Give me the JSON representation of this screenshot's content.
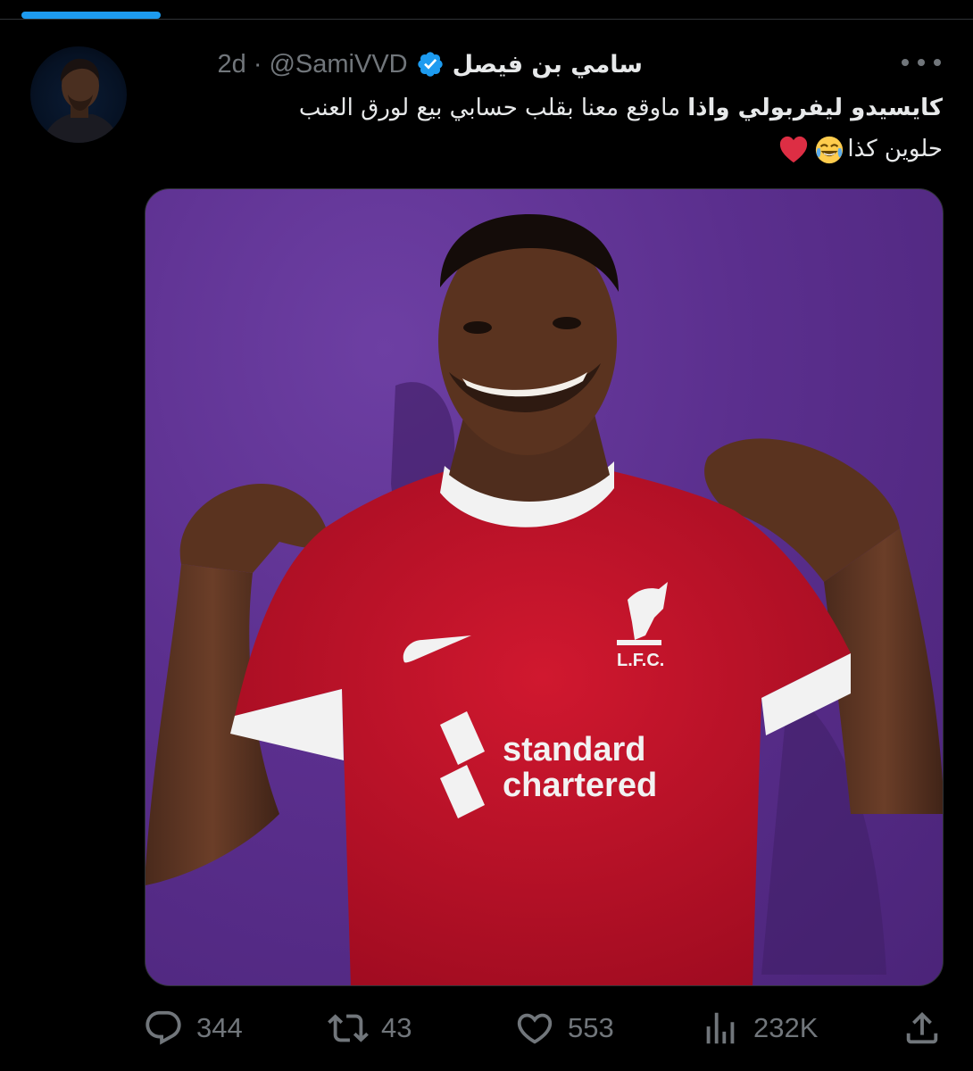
{
  "tweet": {
    "display_name": "سامي بن فيصل",
    "handle": "@SamiVVD",
    "separator": "·",
    "time": "2d",
    "text_bold": "كايسيدو ليفربولي واذا",
    "text_rest": " ماوقع معنا بقلب حسابي بيع لورق العنب",
    "text_line2": "حلوين كذا"
  },
  "media": {
    "sponsor_line1": "standard",
    "sponsor_line2": "chartered",
    "crest_text": "L.F.C."
  },
  "actions": {
    "replies": "344",
    "retweets": "43",
    "likes": "553",
    "views": "232K"
  },
  "icons": [
    "verified-badge-icon",
    "more-icon",
    "reply-icon",
    "retweet-icon",
    "like-icon",
    "views-icon",
    "share-icon",
    "joy-emoji",
    "heart-emoji"
  ],
  "colors": {
    "background": "#000000",
    "accent": "#1d9bf0",
    "muted": "#71767b",
    "text": "#e7e9ea",
    "shirt": "#c8102e",
    "backdrop": "#5b2f8e"
  }
}
